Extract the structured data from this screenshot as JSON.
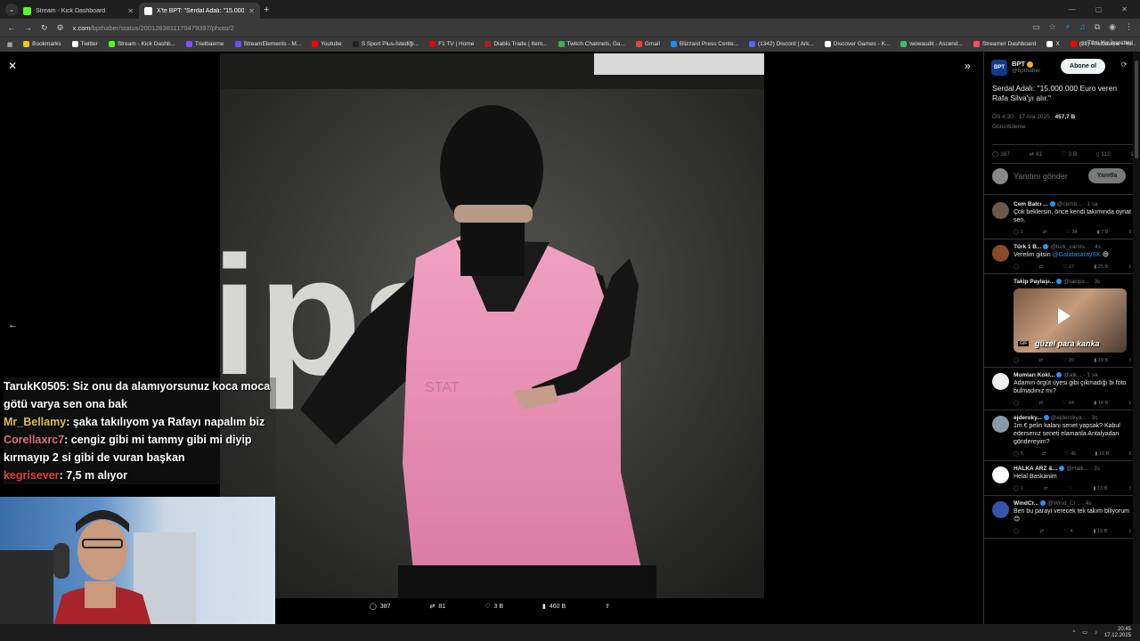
{
  "browser": {
    "tabs": [
      {
        "label": "Stream - Kick Dashboard",
        "color": "#53fc18"
      },
      {
        "label": "X'te BPT: \"Serdal Adalı: \"15.000.000",
        "color": "#ffffff"
      }
    ],
    "url_host": "x.com",
    "url_path": "/bpthaber/status/2001283811179479397/photo/2",
    "bookmarks": [
      {
        "label": "Bookmarks",
        "color": "#f5c518"
      },
      {
        "label": "Twitter",
        "color": "#ffffff"
      },
      {
        "label": "Stream - Kick Dashb...",
        "color": "#53fc18"
      },
      {
        "label": "Trielbaerne",
        "color": "#9146ff"
      },
      {
        "label": "StreamElements - M...",
        "color": "#6b4cff"
      },
      {
        "label": "Youtube",
        "color": "#ff0000"
      },
      {
        "label": "S Sport Plus-İstediği...",
        "color": "#222222"
      },
      {
        "label": "F1 TV | Home",
        "color": "#e10600"
      },
      {
        "label": "Diablo Trade | Item...",
        "color": "#b0201a"
      },
      {
        "label": "Twitch Channels, Ga...",
        "color": "#44aa55"
      },
      {
        "label": "Gmail",
        "color": "#ea4335"
      },
      {
        "label": "Blizzard Press Cente...",
        "color": "#148eff"
      },
      {
        "label": "(1342) Discord | Ark...",
        "color": "#5865f2"
      },
      {
        "label": "Discover Games - K...",
        "color": "#ffffff"
      },
      {
        "label": "wowaudit - Ascend...",
        "color": "#44bb66"
      },
      {
        "label": "Streamer Dashboard",
        "color": "#ff4a6a"
      },
      {
        "label": "X",
        "color": "#ffffff"
      },
      {
        "label": "(23) Trielbaerne - Yo...",
        "color": "#ff0000"
      }
    ],
    "all_bookmarks": "Tüm Yer İşaretleri"
  },
  "viewer": {
    "actions": {
      "comments": "387",
      "reposts": "81",
      "likes": "3 B",
      "views": "460 B"
    }
  },
  "chat": [
    {
      "user": "TarukK0505",
      "text": ": Siz onu da alamıyorsunuz koca moca götü varya sen ona bak",
      "cls": "u0"
    },
    {
      "user": "Mr_Bellamy",
      "text": ": şaka takılıyom ya Rafayı napalım biz",
      "cls": "u1"
    },
    {
      "user": "Corellaxrc7",
      "text": ": cengiz gibi mi tammy gibi mi diyip kırmayıp 2 si gibi de vuran başkan",
      "cls": "u2"
    },
    {
      "user": "kegrisever",
      "text": ": 7,5 m alıyor",
      "cls": "u3"
    }
  ],
  "tweet": {
    "avatar_text": "BPT",
    "name": "BPT",
    "handle": "@bpthaber",
    "subscribe": "Abone ol",
    "text": "Serdal Adalı: \"15.000.000 Euro veren Rafa Silva'yı alır.\"",
    "time": "ÖS 4:30 · 17 Ara 2025 ·",
    "views": "457,7 B",
    "views_label": "Görüntüleme",
    "stats": {
      "comments": "387",
      "reposts": "81",
      "likes": "3 B",
      "bookmarks": "112"
    },
    "reply_placeholder": "Yanıtını gönder",
    "reply_button": "Yanıtla"
  },
  "replies": [
    {
      "name": "Cem Balcı ...",
      "handle": "@cemb...",
      "time": "1 sa",
      "text": "Çok beklersin, önce kendi takımında oynat sen.",
      "c": "1",
      "r": "",
      "l": "34",
      "v": "7 B",
      "color": "#6b5a4a"
    },
    {
      "name": "Türk 1 B...",
      "handle": "@turk_varols...",
      "time": "4s",
      "text": "Verelim gitsin ",
      "mention": "@GalatasaraySK",
      "emoji": " 😅",
      "c": "",
      "r": "",
      "l": "17",
      "v": "25 B",
      "color": "#8a4a2a"
    },
    {
      "name": "Takip Paylaşı...",
      "handle": "@takipv...",
      "time": "3s",
      "text": "",
      "gif": "güzel para kanka",
      "gif_label": "GIF",
      "c": "",
      "r": "",
      "l": "20",
      "v": "19 B",
      "color": "#000000"
    },
    {
      "name": "Mumları Kokl...",
      "handle": "@alk...",
      "time": "1 sa",
      "text": "Adamın örgüt üyesi gibi çıkmadığı bi foto bulmadınız mı?",
      "c": "",
      "r": "",
      "l": "44",
      "v": "14 B",
      "color": "#eeeeee"
    },
    {
      "name": "ejderoky...",
      "handle": "@ejderokya...",
      "time": "3s",
      "text": "1m € pelin kalanı senet yapsak? Kabul edersenız seneti elamanla Antalyadan göndereyim?",
      "c": "5",
      "r": "",
      "l": "45",
      "v": "19 B",
      "color": "#8899aa"
    },
    {
      "name": "HALKA ARZ &...",
      "handle": "@Halk...",
      "time": "3s",
      "text": "Helal Baskanim",
      "c": "1",
      "r": "",
      "l": "",
      "v": "13 B",
      "color": "#ffffff"
    },
    {
      "name": "WindCr...",
      "handle": "@Wind_Cr...",
      "time": "4s",
      "text": "Ben bu parayi verecek tek takım biliyorum 😊",
      "c": "",
      "r": "",
      "l": "4",
      "v": "13 B",
      "color": "#3355aa"
    }
  ],
  "taskbar": {
    "time": "20:45",
    "date": "17.12.2025"
  }
}
